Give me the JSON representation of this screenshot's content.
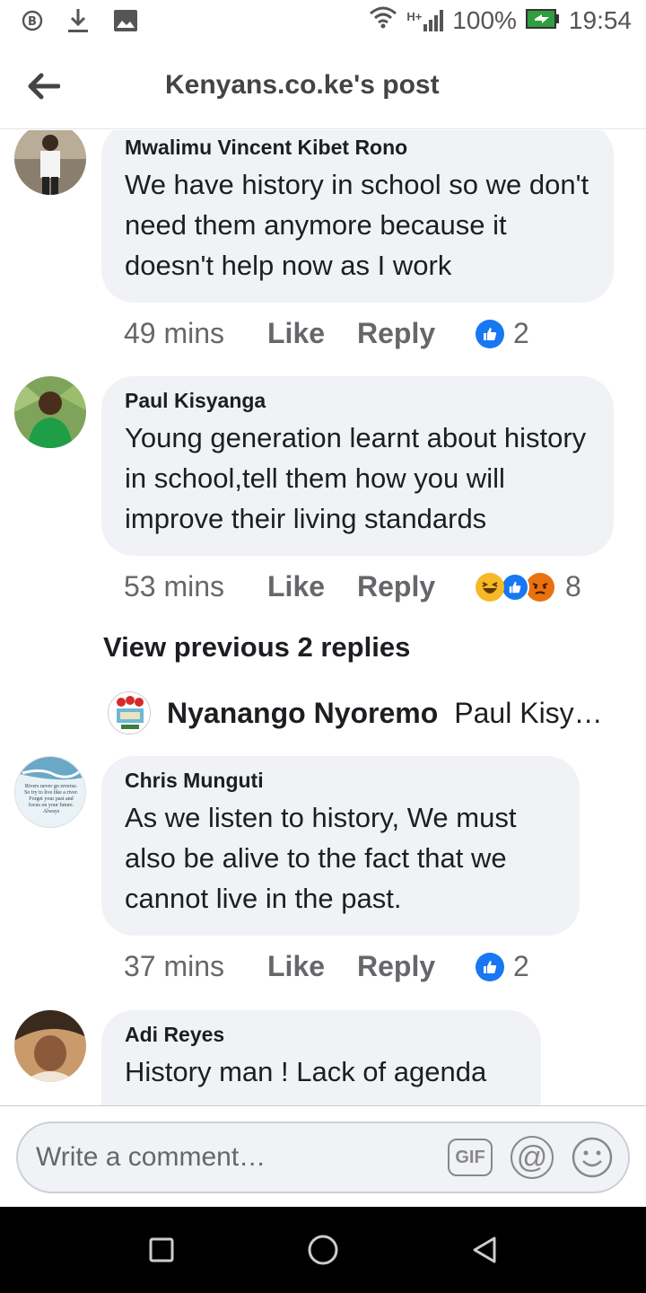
{
  "status_bar": {
    "battery": "100%",
    "time": "19:54",
    "network": "H+",
    "icons": [
      "bitcoin-icon",
      "download-icon",
      "image-icon",
      "wifi-icon",
      "signal-icon",
      "battery-icon"
    ]
  },
  "header": {
    "title": "Kenyans.co.ke's post"
  },
  "comments": [
    {
      "author": "Mwalimu Vincent Kibet Rono",
      "text": "We have history in school so we don't need them anymore because it doesn't help now as I work",
      "time": "49 mins",
      "like_label": "Like",
      "reply_label": "Reply",
      "reaction_count": "2",
      "reactions": [
        "like-reaction-icon"
      ]
    },
    {
      "author": "Paul Kisyanga",
      "text": "Young generation learnt about history in school,tell them how you will improve their living standards",
      "time": "53 mins",
      "like_label": "Like",
      "reply_label": "Reply",
      "reaction_count": "8",
      "reactions": [
        "haha-reaction-icon",
        "like-reaction-icon",
        "angry-reaction-icon"
      ]
    },
    {
      "author": "Chris Munguti",
      "text": "As we listen to history, We must also be alive to the fact that we cannot live in the past.",
      "time": "37 mins",
      "like_label": "Like",
      "reply_label": "Reply",
      "reaction_count": "2",
      "reactions": [
        "like-reaction-icon"
      ],
      "avatar_text": "Rivers never go reverse. So try to live like a river. Forget your past and focus on your future. Always"
    },
    {
      "author": "Adi Reyes",
      "text": "History man ! Lack of agenda"
    }
  ],
  "replies_thread": {
    "view_previous": "View previous 2 replies",
    "reply_author": "Nyanango Nyoremo",
    "reply_preview": "Paul Kisyanga"
  },
  "composer": {
    "placeholder": "Write a comment…",
    "gif_label": "GIF",
    "at_label": "@",
    "icons": [
      "gif-icon",
      "mention-icon",
      "emoji-icon"
    ]
  },
  "colors": {
    "bubble": "#f0f2f5",
    "like_blue": "#1877f2",
    "haha_yellow": "#f7b928",
    "angry_orange": "#e9710f",
    "muted_text": "#65676b"
  }
}
